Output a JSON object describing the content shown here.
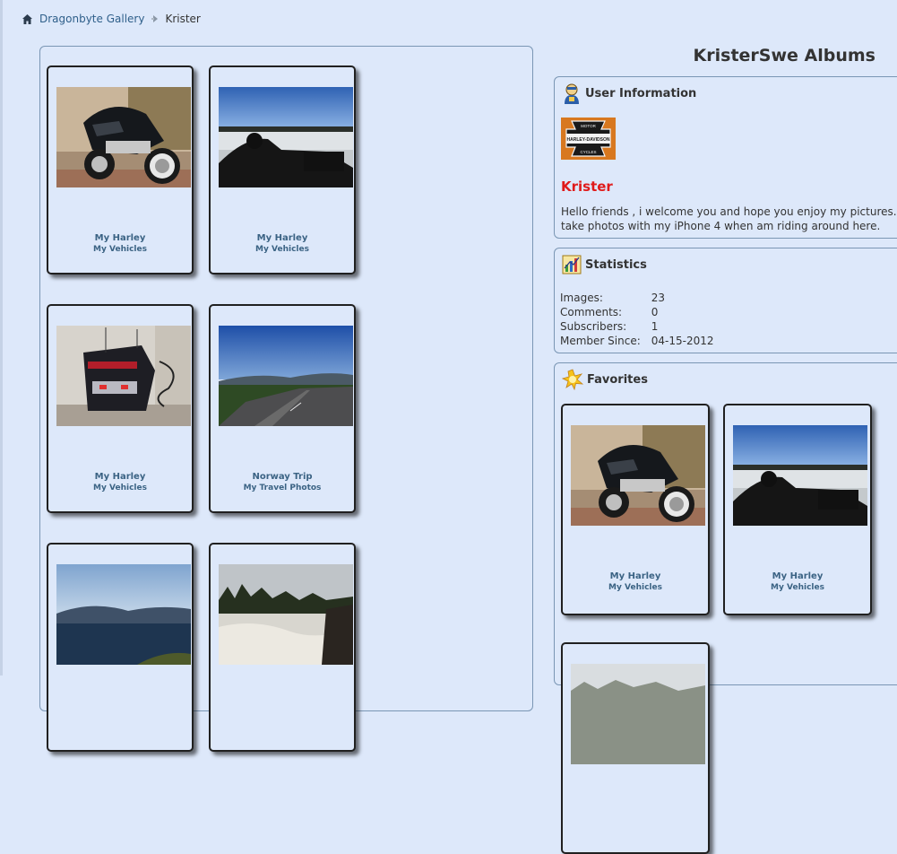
{
  "breadcrumb": {
    "home_label": "Dragonbyte Gallery",
    "current": "Krister"
  },
  "page_title": "KristerSwe Albums",
  "albums": [
    {
      "title": "My Harley",
      "album": "My Vehicles",
      "image": "motorcycle-front"
    },
    {
      "title": "My Harley",
      "album": "My Vehicles",
      "image": "motorcycle-lake"
    },
    {
      "title": "My Harley",
      "album": "My Vehicles",
      "image": "motorcycle-rear"
    },
    {
      "title": "Norway Trip",
      "album": "My Travel Photos",
      "image": "road-landscape"
    },
    {
      "title": "",
      "album": "",
      "image": "lake-mountains"
    },
    {
      "title": "",
      "album": "",
      "image": "river-rapids"
    }
  ],
  "user_info": {
    "header": "User Information",
    "avatar": "harley-davidson-logo",
    "avatar_text": [
      "MOTOR",
      "HARLEY-DAVIDSON",
      "CYCLES"
    ],
    "username": "Krister",
    "bio_line1": "Hello friends , i welcome you and hope you enjoy my pictures. fee",
    "bio_line2": "take photos with my iPhone 4 when am riding around here."
  },
  "statistics": {
    "header": "Statistics",
    "rows": [
      {
        "label": "Images:",
        "value": "23"
      },
      {
        "label": "Comments:",
        "value": "0"
      },
      {
        "label": "Subscribers:",
        "value": "1"
      },
      {
        "label": "Member Since:",
        "value": "04-15-2012"
      }
    ]
  },
  "favorites": {
    "header": "Favorites",
    "items": [
      {
        "title": "My Harley",
        "album": "My Vehicles",
        "image": "motorcycle-front"
      },
      {
        "title": "My Harley",
        "album": "My Vehicles",
        "image": "motorcycle-lake"
      },
      {
        "title": "",
        "album": "",
        "image": "landscape-partial"
      }
    ]
  },
  "colors": {
    "background": "#dde8fa",
    "link": "#2f5f8a",
    "username": "#e01a1a",
    "card_caption": "#3b6384",
    "panel_border": "#7a96b4"
  }
}
